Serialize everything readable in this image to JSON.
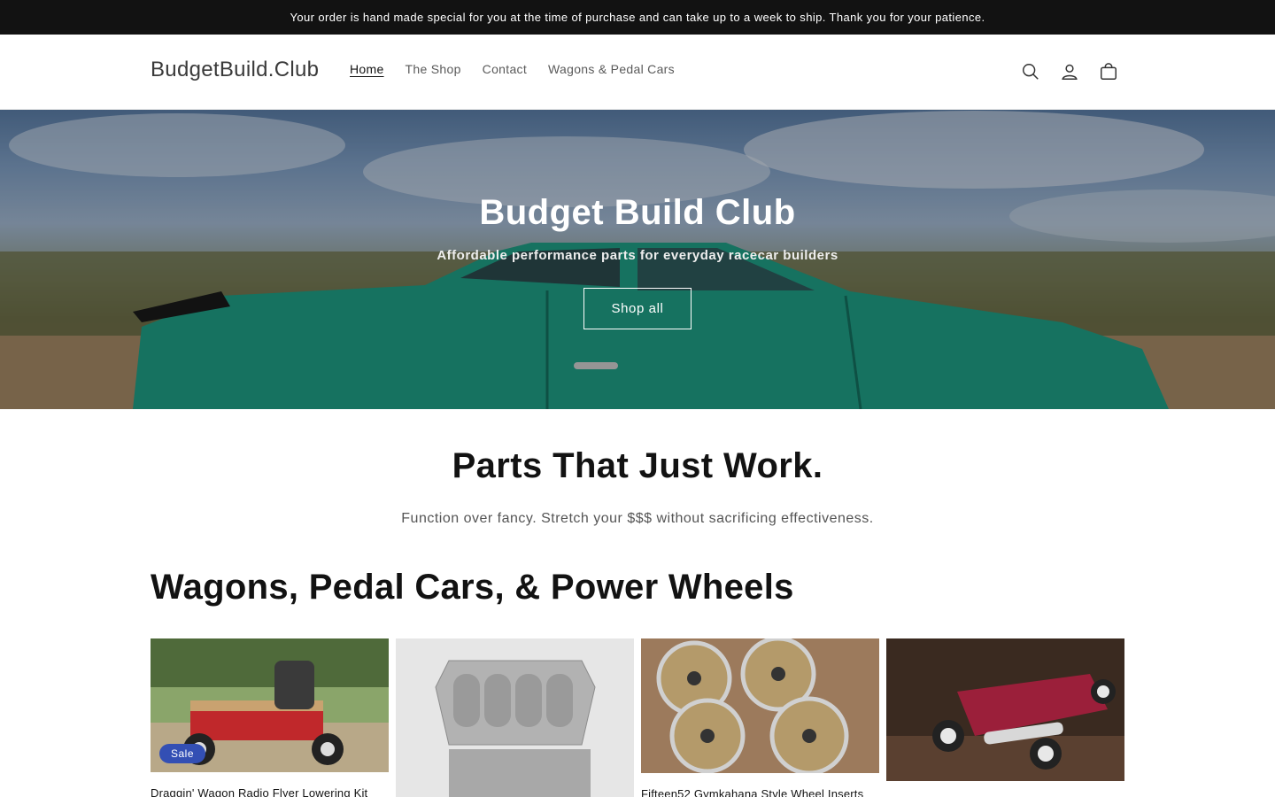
{
  "announcement": {
    "text": "Your order is hand made special for you at the time of purchase and can take up to a week to ship. Thank you for your patience."
  },
  "header": {
    "logo": "BudgetBuild.Club",
    "nav": [
      {
        "label": "Home",
        "active": true
      },
      {
        "label": "The Shop",
        "active": false
      },
      {
        "label": "Contact",
        "active": false
      },
      {
        "label": "Wagons & Pedal Cars",
        "active": false
      }
    ],
    "icons": [
      "search-icon",
      "account-icon",
      "cart-icon"
    ]
  },
  "hero": {
    "title": "Budget Build Club",
    "subtitle": "Affordable performance parts for everyday racecar builders",
    "button": "Shop all"
  },
  "intro": {
    "title": "Parts That Just Work.",
    "text": "Function over fancy. Stretch your $$$ without sacrificing effectiveness."
  },
  "collection": {
    "title": "Wagons, Pedal Cars, & Power Wheels",
    "products": [
      {
        "title": "Draggin' Wagon Radio Flyer Lowering Kit",
        "badge": "Sale"
      },
      {
        "title": "",
        "badge": ""
      },
      {
        "title": "Fifteen52 Gymkahana Style Wheel Inserts",
        "badge": ""
      },
      {
        "title": "",
        "badge": ""
      }
    ]
  },
  "colors": {
    "announcement_bg": "#121212",
    "sale_badge": "#334fb4",
    "car_teal": "#1f9e86"
  }
}
